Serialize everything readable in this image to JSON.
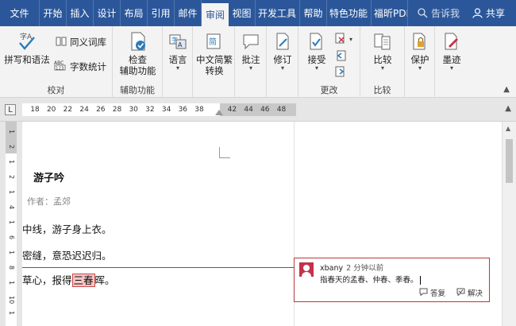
{
  "tabs": [
    {
      "label": "文件",
      "w": "w-file"
    },
    {
      "label": "开始",
      "w": "w2"
    },
    {
      "label": "插入",
      "w": "w2"
    },
    {
      "label": "设计",
      "w": "w2"
    },
    {
      "label": "布局",
      "w": "w2"
    },
    {
      "label": "引用",
      "w": "w2"
    },
    {
      "label": "邮件",
      "w": "w2"
    },
    {
      "label": "审阅",
      "w": "w2",
      "active": true
    },
    {
      "label": "视图",
      "w": "w2"
    },
    {
      "label": "开发工具",
      "w": "w4"
    },
    {
      "label": "帮助",
      "w": "w2"
    },
    {
      "label": "特色功能",
      "w": "w4"
    },
    {
      "label": "福昕PDF",
      "w": "w3"
    }
  ],
  "tell_me": "告诉我",
  "share": "共享",
  "ribbon": {
    "proofing": {
      "spelling": "拼写和语法",
      "thesaurus": "同义词库",
      "word_count": "字数统计",
      "group": "校对"
    },
    "accessibility": {
      "check_line1": "检查",
      "check_line2": "辅助功能",
      "group": "辅助功能"
    },
    "language": {
      "label": "语言"
    },
    "chinese": {
      "line1": "中文简繁",
      "line2": "转换"
    },
    "comments": {
      "label": "批注"
    },
    "tracking": {
      "label": "修订"
    },
    "changes": {
      "accept": "接受",
      "group": "更改"
    },
    "compare": {
      "label": "比较",
      "group": "比较"
    },
    "protect": {
      "label": "保护"
    },
    "ink": {
      "label": "墨迹"
    }
  },
  "ruler": {
    "corner": "L",
    "ticks": [
      "18",
      "20",
      "22",
      "24",
      "26",
      "28",
      "30",
      "32",
      "34",
      "36",
      "38",
      "",
      "42",
      "44",
      "46",
      "48"
    ]
  },
  "vruler": {
    "ticks": [
      "1",
      "2",
      "1",
      "2",
      "1",
      "4",
      "1",
      "6",
      "1",
      "8",
      "1",
      "10",
      "1"
    ]
  },
  "document": {
    "title": "游子吟",
    "author": "作者：孟郊",
    "line1": "中线，游子身上衣。",
    "line2": "密缝，意恐迟迟归。",
    "line3_pre": "草心，报得",
    "line3_highlight": "三春",
    "line3_post": "晖。"
  },
  "comment": {
    "author": "xbany",
    "time": "2 分钟以前",
    "text": "指春天的孟春、仲春、季春。",
    "reply": "答复",
    "resolve": "解决"
  }
}
